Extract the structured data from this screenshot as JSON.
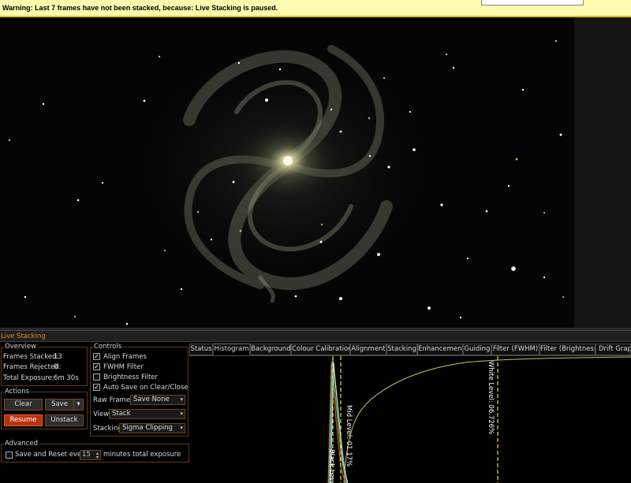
{
  "warning": {
    "text": "Warning: Last 7 frames have not been stacked, because: Live Stacking is paused."
  },
  "panel": {
    "title": "Live Stacking"
  },
  "overview": {
    "title": "Overview",
    "frames_stacked_label": "Frames Stacked:",
    "frames_stacked": "13",
    "frames_rejected_label": "Frames Rejected:",
    "frames_rejected": "0",
    "total_exposure_label": "Total Exposure:",
    "total_exposure": "6m 30s"
  },
  "actions": {
    "title": "Actions",
    "clear": "Clear",
    "save": "Save",
    "resume": "Resume",
    "unstack": "Unstack"
  },
  "advanced": {
    "title": "Advanced",
    "label_before": "Save and Reset every",
    "minutes": "15",
    "label_after": "minutes total exposure"
  },
  "controls": {
    "title": "Controls",
    "align_frames": "Align Frames",
    "fwhm_filter": "FWHM Filter",
    "brightness_filter": "Brightness Filter",
    "auto_save": "Auto Save on Clear/Close",
    "raw_frames_label": "Raw Frames",
    "raw_frames_value": "Save None",
    "view_label": "View",
    "view_value": "Stack",
    "stacking_label": "Stacking",
    "stacking_value": "Sigma Clipping"
  },
  "tabs": [
    "Status",
    "Histogram",
    "Background",
    "Colour Calibration",
    "Alignment",
    "Stacking",
    "Enhancement",
    "Guiding",
    "Filter (FWHM)",
    "Filter (Brightness)",
    "Drift Graph"
  ],
  "histogram": {
    "white_level": "White Level: 06.726%",
    "mid_level": "Mid Level: 01.17%",
    "black_level": "Black Level"
  },
  "colors": {
    "accent": "#e08a2a",
    "warning_bg": "#fffcb0",
    "resume_bg": "#b8320e",
    "group_border": "#5c3a12"
  }
}
